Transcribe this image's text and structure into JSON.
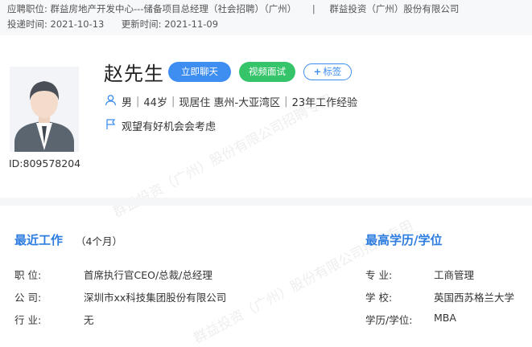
{
  "header": {
    "applied_label": "应聘职位:",
    "applied_value": "群益房地产开发中心---储备项目总经理（社会招聘）（广州）",
    "separator": "|",
    "company": "群益投资（广州）股份有限公司",
    "delivered_label": "投递时间:",
    "delivered_value": "2021-10-13",
    "updated_label": "更新时间:",
    "updated_value": "2021-11-09"
  },
  "candidate": {
    "name": "赵先生",
    "id_text": "ID:809578204",
    "gender": "男",
    "age": "44岁",
    "residence": "现居住 惠州-大亚湾区",
    "experience": "23年工作经验",
    "status": "观望有好机会会考虑"
  },
  "actions": {
    "chat_label": "立即聊天",
    "video_label": "视频面试",
    "tag_label": "标签"
  },
  "watermark": {
    "text1": "群益投资（广州）股份有限公司招聘专用",
    "text2": "群益投资（广州）股份有限公司招聘专用"
  },
  "recent_work": {
    "title": "最近工作",
    "duration": "（4个月）",
    "rows": [
      {
        "label": "职    位:",
        "value": "首席执行官CEO/总裁/总经理"
      },
      {
        "label": "公    司:",
        "value": "深圳市xx科技集团股份有限公司"
      },
      {
        "label": "行    业:",
        "value": "无"
      }
    ]
  },
  "education": {
    "title": "最高学历/学位",
    "rows": [
      {
        "label": "专    业:",
        "value": "工商管理"
      },
      {
        "label": "学    校:",
        "value": "英国西苏格兰大学"
      },
      {
        "label": "学历/学位:",
        "value": "MBA"
      }
    ]
  },
  "colors": {
    "accent": "#3d8ef0",
    "video": "#35c46a",
    "section_title": "#2d7de0"
  }
}
